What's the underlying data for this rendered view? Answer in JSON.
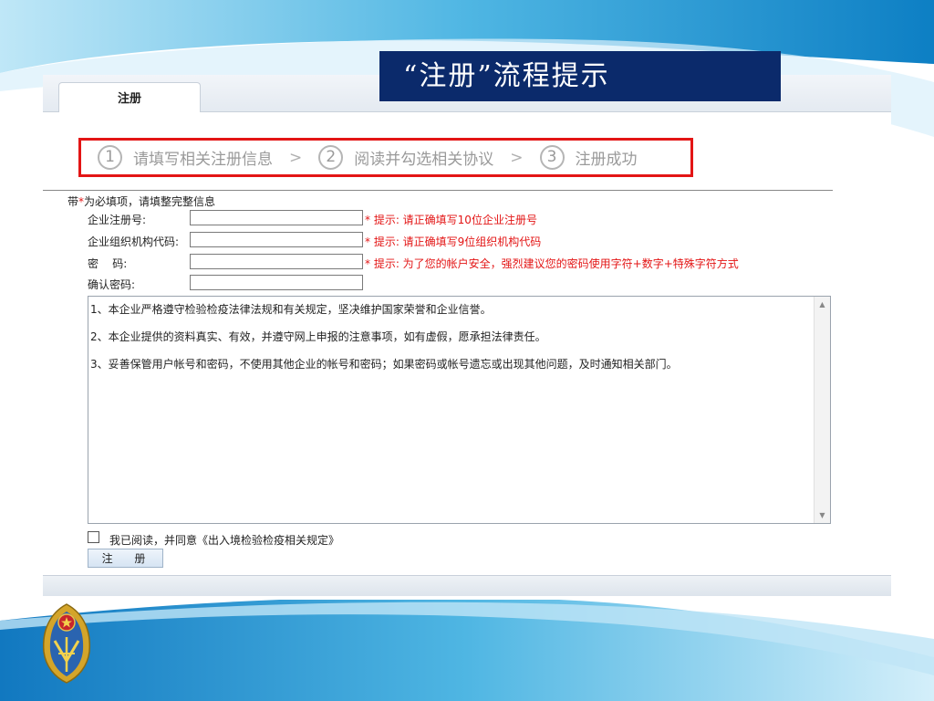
{
  "slide": {
    "title": "“注册”流程提示"
  },
  "tabs": [
    {
      "label": "注册"
    }
  ],
  "steps": [
    {
      "num": "1",
      "label": "请填写相关注册信息"
    },
    {
      "num": "2",
      "label": "阅读并勾选相关协议"
    },
    {
      "num": "3",
      "label": "注册成功"
    }
  ],
  "step_separator": ">",
  "required_note": {
    "prefix": "带",
    "star": "*",
    "text": "为必填项，请填整完整信息"
  },
  "form": {
    "fields": [
      {
        "label": "企业注册号:",
        "value": "",
        "hint": "* 提示: 请正确填写10位企业注册号"
      },
      {
        "label": "企业组织机构代码:",
        "value": "",
        "hint": "* 提示: 请正确填写9位组织机构代码"
      },
      {
        "label": "密    码:",
        "value": "",
        "hint": "* 提示: 为了您的帐户安全，强烈建议您的密码使用字符+数字+特殊字符方式"
      },
      {
        "label": "确认密码:",
        "value": "",
        "hint": ""
      }
    ]
  },
  "agreement": {
    "items": [
      "1、本企业严格遵守检验检疫法律法规和有关规定，坚决维护国家荣誉和企业信誉。",
      "2、本企业提供的资料真实、有效，并遵守网上申报的注意事项，如有虚假，愿承担法律责任。",
      "3、妥善保管用户帐号和密码，不使用其他企业的帐号和密码；如果密码或帐号遗忘或出现其他问题，及时通知相关部门。"
    ]
  },
  "agree_checkbox": {
    "label": "我已阅读，并同意《出入境检验检疫相关规定》",
    "checked": false
  },
  "register_button": {
    "label": "注 册"
  },
  "icons": {
    "emblem": "emblem-logo",
    "scroll_up": "triangle-up-icon",
    "scroll_down": "triangle-down-icon"
  },
  "colors": {
    "title_bg": "#0b2a6b",
    "highlight_border": "#e31515",
    "hint_text": "#e31515"
  }
}
